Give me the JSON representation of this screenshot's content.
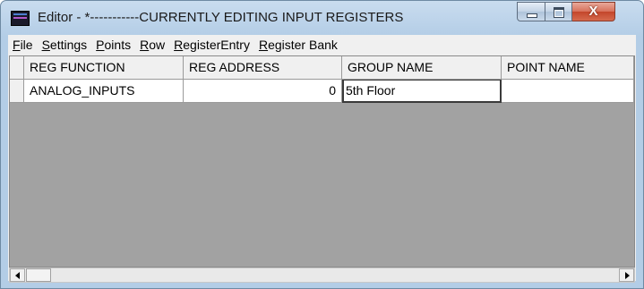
{
  "window": {
    "title": "Editor -  *-----------CURRENTLY EDITING INPUT REGISTERS",
    "icon": "app-icon"
  },
  "caption_buttons": {
    "minimize_icon": "minimize-icon",
    "maximize_icon": "maximize-icon",
    "close_glyph": "X"
  },
  "menu": [
    {
      "underline": "F",
      "rest": "ile"
    },
    {
      "underline": "S",
      "rest": "ettings"
    },
    {
      "underline": "P",
      "rest": "oints"
    },
    {
      "underline": "R",
      "rest": "ow"
    },
    {
      "underline": "R",
      "rest": "egisterEntry"
    },
    {
      "underline": "R",
      "rest": "egister Bank"
    }
  ],
  "grid": {
    "columns": [
      "REG FUNCTION",
      "REG ADDRESS",
      "GROUP NAME",
      "POINT NAME"
    ],
    "rows": [
      {
        "reg_function": "ANALOG_INPUTS",
        "reg_address": "0",
        "group_name": "5th Floor",
        "point_name": ""
      }
    ]
  }
}
